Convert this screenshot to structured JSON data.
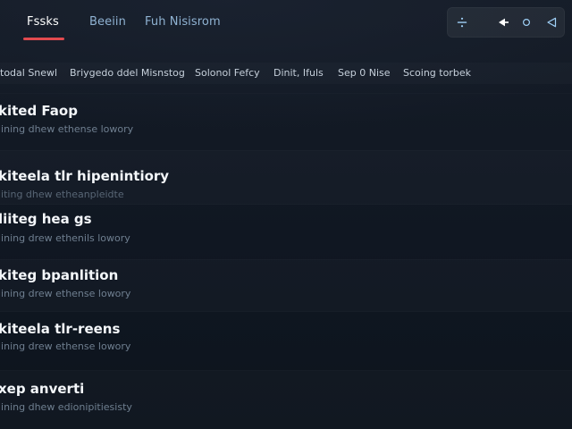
{
  "nav": {
    "tabs": [
      {
        "label": "Fssks"
      },
      {
        "label": "Beeiin"
      },
      {
        "label": "Fuh Nisisrom"
      }
    ]
  },
  "toolbar": {
    "icons": [
      "divide-icon",
      "pointer-icon",
      "small-circle-icon",
      "back-triangle-icon"
    ]
  },
  "filters": [
    {
      "label": "todal Snewl"
    },
    {
      "label": "Briygedo ddel Misnstog"
    },
    {
      "label": "Solonol Fefcy"
    },
    {
      "label": "Dinit, Ifuls"
    },
    {
      "label": "Sep 0 Nise"
    },
    {
      "label": "Scoing torbek"
    }
  ],
  "rows": [
    {
      "title": "kited Faop",
      "subtitle": "lining dhew ethense lowory"
    },
    {
      "title": "kiteela tlr hipenintiory",
      "subtitle": "liting dhew etheanpleidte"
    },
    {
      "title": "liiteg hea gs",
      "subtitle": "lining drew ethenils lowory"
    },
    {
      "title": "kiteg bpanlition",
      "subtitle": "lining drew ethense lowory"
    },
    {
      "title": "kiteela tlr-reens",
      "subtitle": "lining drew ethense lowory"
    },
    {
      "title": "xep anverti",
      "subtitle": "lining dhew edionipitiesisty"
    }
  ],
  "colors": {
    "accent": "#e24a4f",
    "tab_inactive": "#8fb2d2",
    "background": "#0f1620"
  }
}
